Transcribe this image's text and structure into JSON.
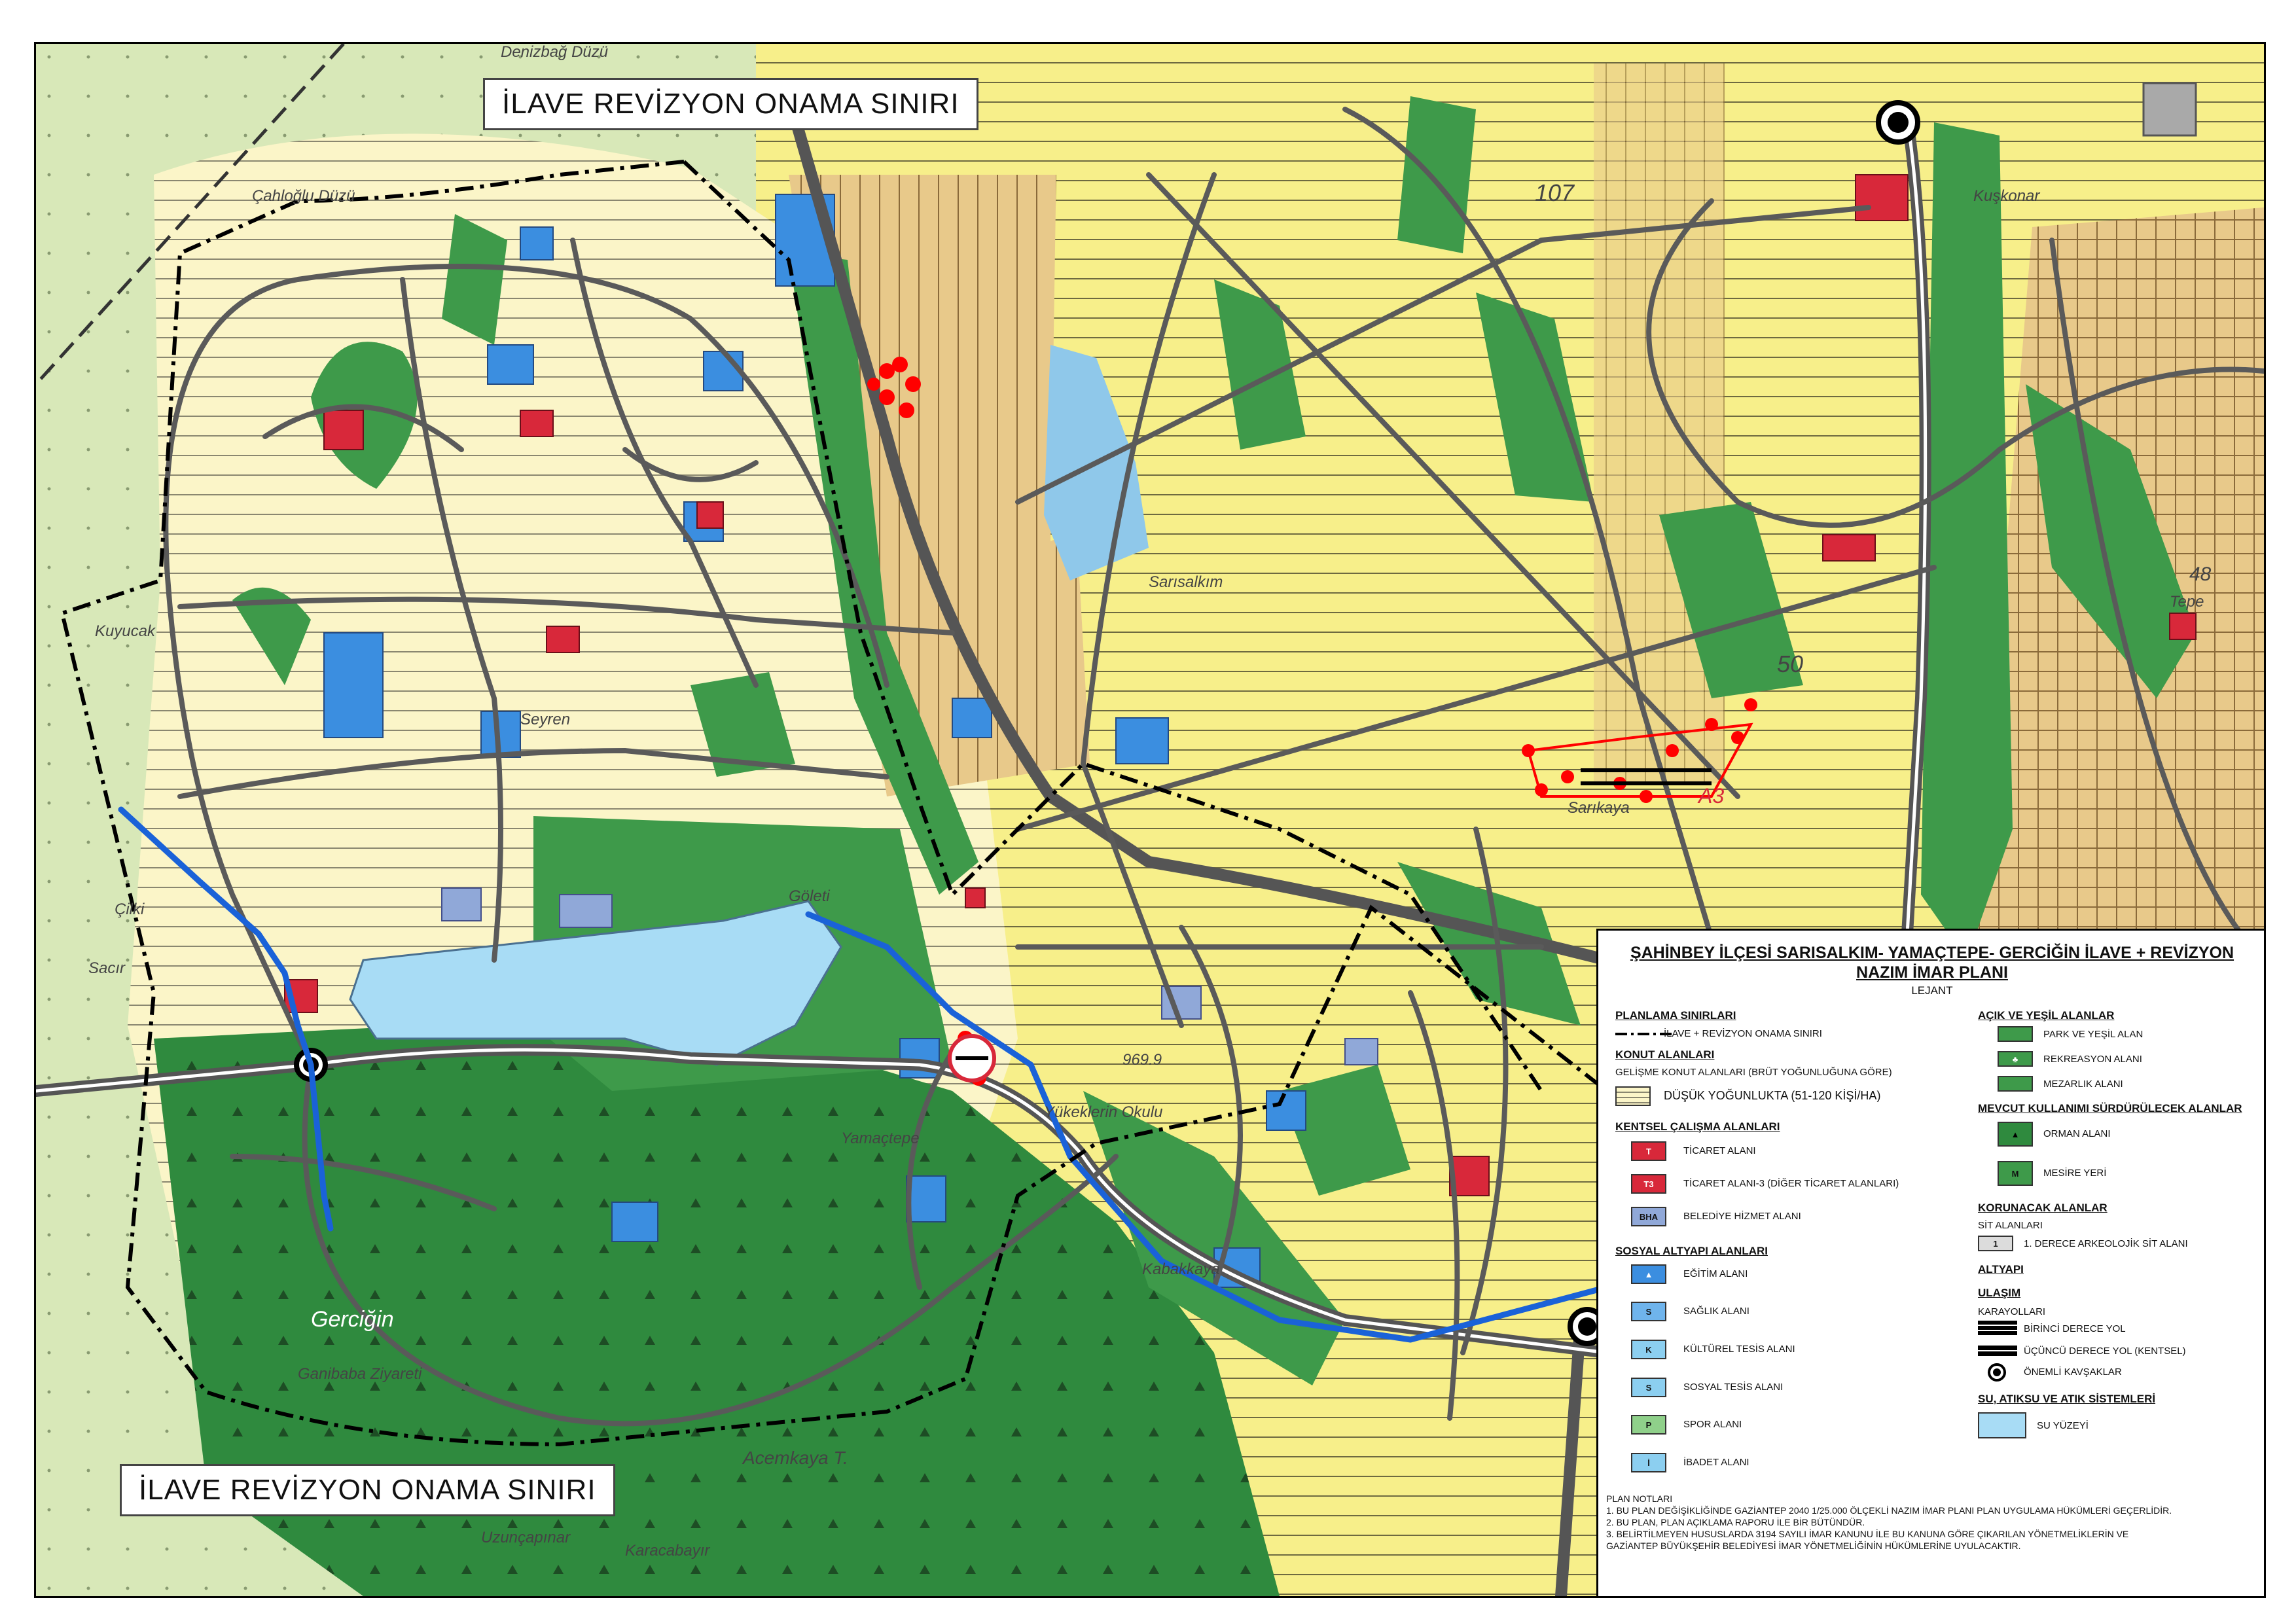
{
  "callouts": {
    "top": "İLAVE REVİZYON ONAMA SINIRI",
    "bottom": "İLAVE REVİZYON ONAMA SINIRI"
  },
  "place_labels": [
    "Denizbağ Düzü",
    "Çahloğlu Düzü",
    "Kuyucak",
    "Seyren",
    "Sacır",
    "Çilki",
    "Gerciğin",
    "Ganibaba Ziyareti",
    "Yamaçtepe",
    "Acemkaya T.",
    "Uzunçapınar",
    "Karacabayır",
    "Göleti",
    "Kabakkaya",
    "Sarıkaya",
    "Yükeklerin Okulu",
    "Sarısalkım",
    "Tepe",
    "Kuşkonar",
    "969.9",
    "107",
    "50",
    "48",
    "A3"
  ],
  "legend": {
    "title": "ŞAHİNBEY İLÇESİ SARISALKIM- YAMAÇTEPE- GERCİĞİN İLAVE + REVİZYON",
    "title2": "NAZIM İMAR PLANI",
    "subtitle": "LEJANT",
    "sections": {
      "planlama": "PLANLAMA SINIRLARI",
      "planlama_item": "İLAVE + REVİZYON ONAMA SINIRI",
      "konut": "KONUT ALANLARI",
      "konut_sub": "GELİŞME KONUT ALANLARI (BRÜT YOĞUNLUĞUNA GÖRE)",
      "konut_item": "DÜŞÜK YOĞUNLUKTA (51-120 KİŞİ/HA)",
      "kentsel": "KENTSEL ÇALIŞMA ALANLARI",
      "ticaret": "TİCARET ALANI",
      "ticaret3": "TİCARET ALANI-3 (DİĞER TİCARET ALANLARI)",
      "belediye": "BELEDİYE HİZMET ALANI",
      "sosyal": "SOSYAL ALTYAPI ALANLARI",
      "egitim": "EĞİTİM ALANI",
      "saglik": "SAĞLIK ALANI",
      "kultur": "KÜLTÜREL TESİS ALANI",
      "sosyaltesis": "SOSYAL TESİS ALANI",
      "spor": "SPOR ALANI",
      "ibadet": "İBADET ALANI",
      "acik": "AÇIK VE YEŞİL ALANLAR",
      "park": "PARK VE YEŞİL ALAN",
      "rekreasyon": "REKREASYON ALANI",
      "mezarlik": "MEZARLIK ALANI",
      "mevcut": "MEVCUT KULLANIMI SÜRDÜRÜLECEK ALANLAR",
      "orman": "ORMAN ALANI",
      "mesire": "MESİRE YERİ",
      "korunacak": "KORUNACAK ALANLAR",
      "sit": "SİT ALANLARI",
      "arkeo": "1. DERECE ARKEOLOJİK SİT ALANI",
      "altyapi": "ALTYAPI",
      "ulasim": "ULAŞIM",
      "karayollari": "KARAYOLLARI",
      "birinci": "BİRİNCİ DERECE YOL",
      "ucuncu": "ÜÇÜNCÜ DERECE YOL (KENTSEL)",
      "kavsak": "ÖNEMLİ KAVŞAKLAR",
      "su": "SU, ATIKSU VE ATIK SİSTEMLERİ",
      "suyuzeyi": "SU YÜZEYİ"
    },
    "swatch_codes": {
      "ticaret": "T",
      "ticaret3": "T3",
      "belediye": "BHA",
      "arkeo": "1"
    },
    "notes_title": "PLAN NOTLARI",
    "notes": [
      "1. BU PLAN DEĞİŞİKLİĞİNDE GAZİANTEP 2040 1/25.000 ÖLÇEKLİ NAZIM İMAR PLANI PLAN UYGULAMA HÜKÜMLERİ GEÇERLİDİR.",
      "2. BU PLAN, PLAN AÇIKLAMA RAPORU İLE BİR BÜTÜNDÜR.",
      "3. BELİRTİLMEYEN HUSUSLARDA 3194 SAYILI İMAR KANUNU İLE BU KANUNA GÖRE ÇIKARILAN YÖNETMELİKLERİN VE",
      "GAZİANTEP BÜYÜKŞEHİR BELEDİYESİ İMAR YÖNETMELİĞİNİN HÜKÜMLERİNE UYULACAKTIR."
    ]
  },
  "colors": {
    "residential": "#fbf5c8",
    "residential_yellow": "#f7ef8a",
    "tan": "#e8c98a",
    "park": "#3e9a4a",
    "forest": "#2f8a3e",
    "water": "#a8dcf5",
    "river": "#1a62d8",
    "commercial": "#d8283a",
    "education": "#3b8ee0",
    "road": "#555555",
    "outer_zone": "#d8e8b8"
  }
}
